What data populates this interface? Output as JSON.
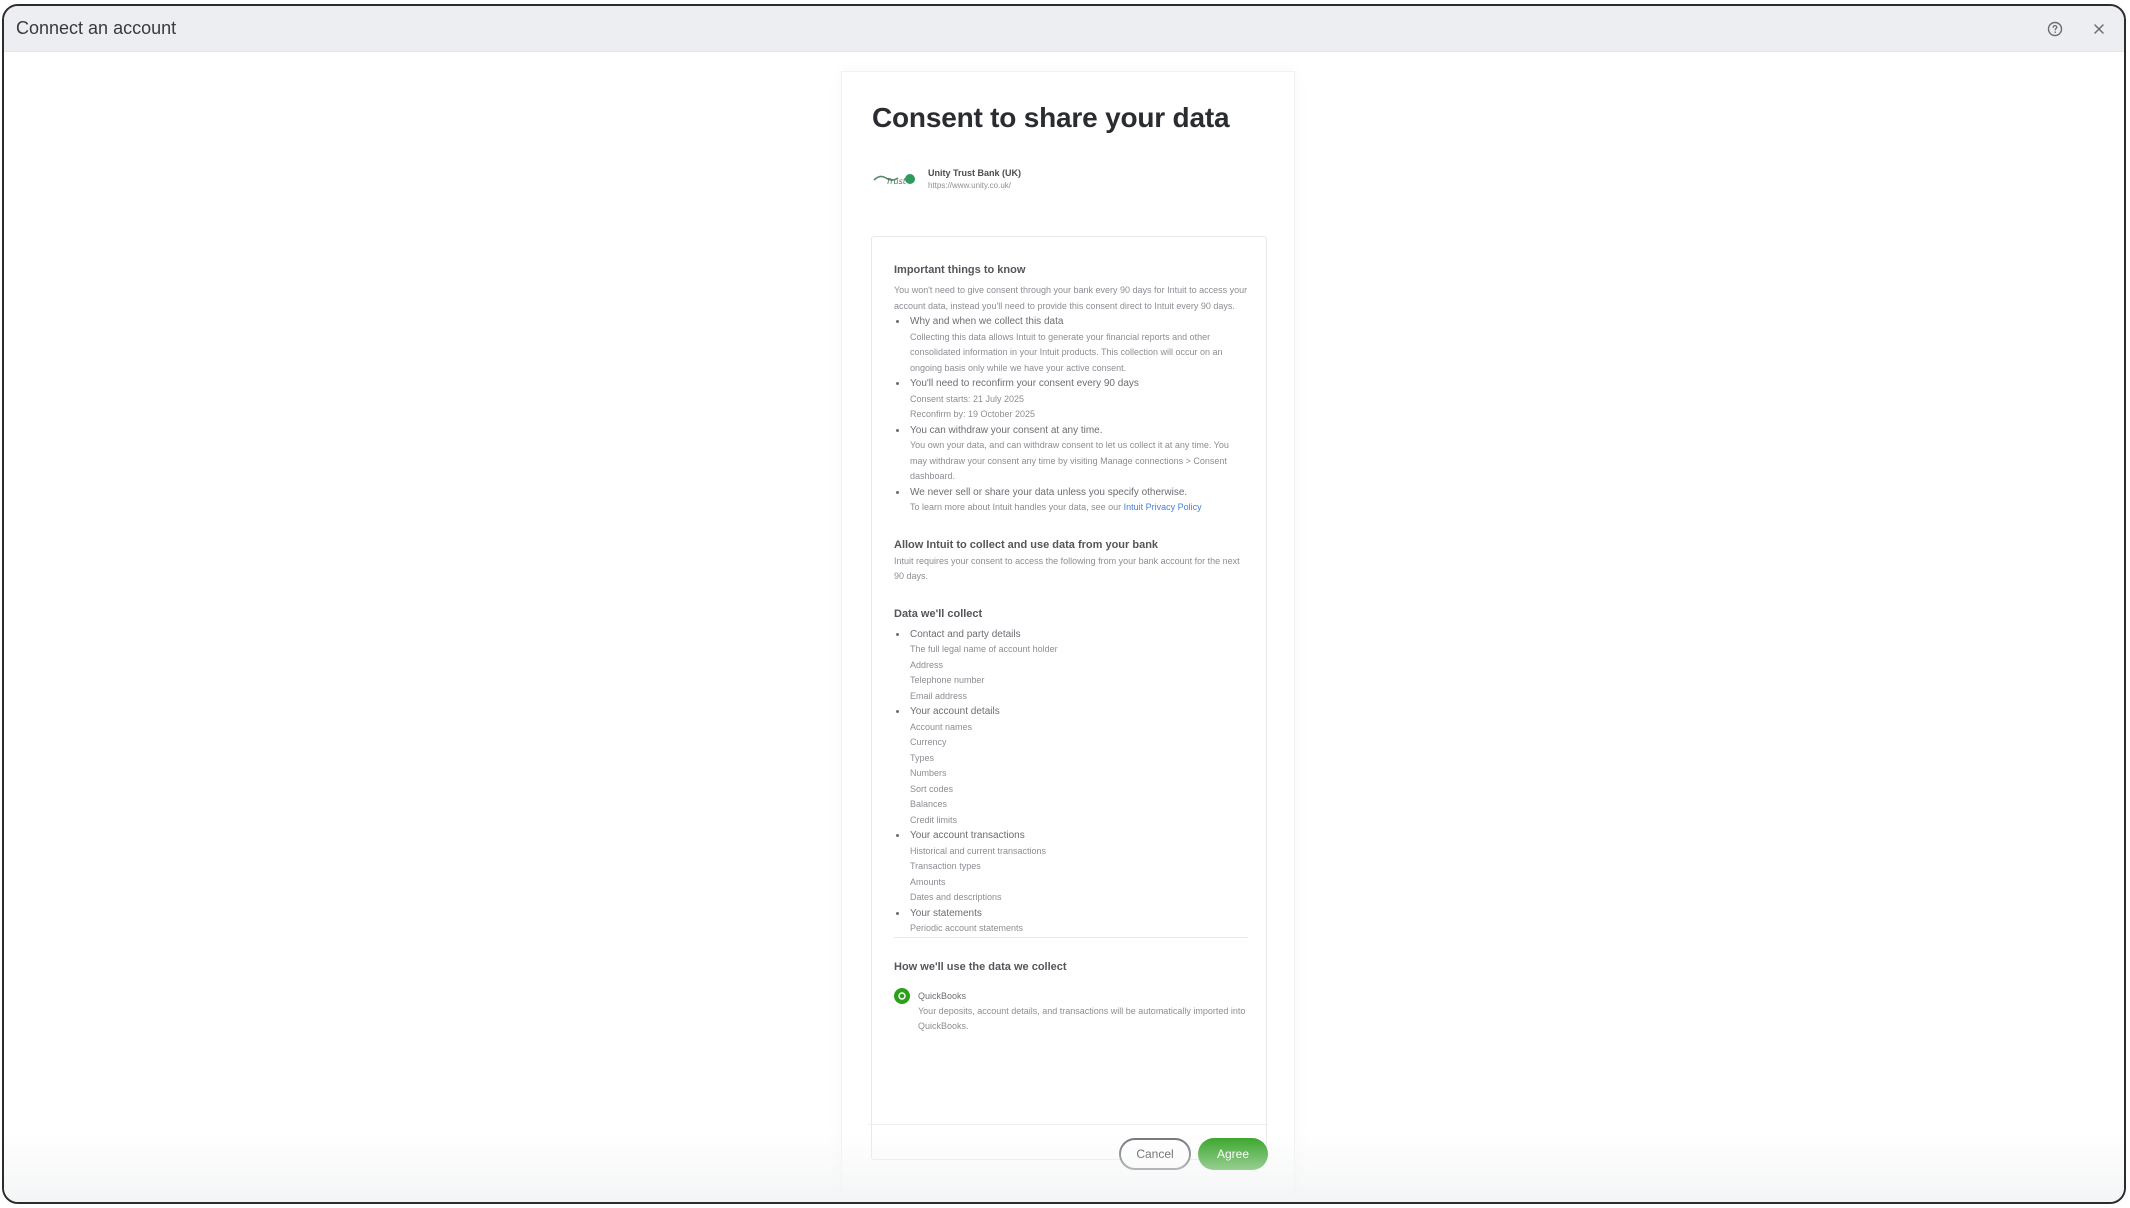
{
  "window": {
    "title": "Connect an account"
  },
  "consent": {
    "heading": "Consent to share your data",
    "bank": {
      "name": "Unity Trust Bank (UK)",
      "url": "https://www.unity.co.uk/"
    },
    "important": {
      "title": "Important things to know",
      "intro": "You won't need to give consent through your bank every 90 days for Intuit to access your account data, instead you'll need to provide this consent direct to Intuit every 90 days.",
      "items": [
        {
          "head": "Why and when we collect this data",
          "sub": "Collecting this data allows Intuit to generate your financial reports and other consolidated information in your Intuit products. This collection will occur on an ongoing basis only while we have your active consent."
        },
        {
          "head": "You'll need to reconfirm your consent every 90 days",
          "sub": "Consent starts: 21 July 2025",
          "sub2": "Reconfirm by: 19 October 2025"
        },
        {
          "head": "You can withdraw your consent at any time.",
          "sub": "You own your data, and can withdraw consent to let us collect it at any time. You may withdraw your consent any time by visiting Manage connections > Consent dashboard."
        },
        {
          "head": "We never sell or share your data unless you specify otherwise.",
          "sub": "To learn more about Intuit handles your data, see our",
          "link": "Intuit Privacy Policy"
        }
      ]
    },
    "allow": {
      "title": "Allow Intuit to collect and use data from your bank",
      "text": "Intuit requires your consent to access the following from your bank account for the next 90 days."
    },
    "collect": {
      "title": "Data we'll collect",
      "groups": [
        {
          "head": "Contact and party details",
          "items": [
            "The full legal name of account holder",
            "Address",
            "Telephone number",
            "Email address"
          ]
        },
        {
          "head": "Your account details",
          "items": [
            "Account names",
            "Currency",
            "Types",
            "Numbers",
            "Sort codes",
            "Balances",
            "Credit limits"
          ]
        },
        {
          "head": "Your account transactions",
          "items": [
            "Historical and current transactions",
            "Transaction types",
            "Amounts",
            "Dates and descriptions"
          ]
        },
        {
          "head": "Your statements",
          "items": [
            "Periodic account statements"
          ]
        }
      ]
    },
    "usage": {
      "title": "How we'll use the data we collect",
      "product": "QuickBooks",
      "description": "Your deposits, account details, and transactions will be automatically imported into QuickBooks."
    }
  },
  "actions": {
    "cancel": "Cancel",
    "agree": "Agree"
  },
  "colors": {
    "brand_green": "#2ca01c",
    "link_blue": "#4a7fd6"
  }
}
